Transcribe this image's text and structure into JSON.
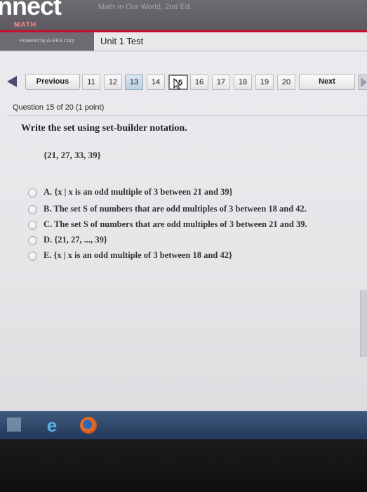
{
  "header": {
    "logo_text": "nnect",
    "subtitle": "Math in Our World, 2nd Ed.",
    "math_label": "MATH",
    "powered_by": "Powered by ALEKS Corp"
  },
  "test_title": "Unit 1 Test",
  "navigation": {
    "previous_label": "Previous",
    "next_label": "Next",
    "question_numbers": [
      "11",
      "12",
      "13",
      "14",
      "15",
      "16",
      "17",
      "18",
      "19",
      "20"
    ],
    "current_question": "15",
    "answered": [
      "13"
    ]
  },
  "question": {
    "info": "Question 15 of 20 (1 point)",
    "prompt": "Write the set using set-builder notation.",
    "set": "{21, 27, 33, 39}",
    "choices": [
      {
        "letter": "A.",
        "text": "{x | x is an odd multiple of 3 between 21 and 39}"
      },
      {
        "letter": "B.",
        "text": "The set S of numbers that are odd multiples of 3 between 18 and 42."
      },
      {
        "letter": "C.",
        "text": "The set S of numbers that are odd multiples of 3 between 21 and 39."
      },
      {
        "letter": "D.",
        "text": "{21, 27, ..., 39}"
      },
      {
        "letter": "E.",
        "text": "{x | x is an odd multiple of 3 between 18 and 42}"
      }
    ]
  },
  "colors": {
    "header_bg": "#6d6a70",
    "accent_red": "#c8102e",
    "taskbar_bg": "#2b4468"
  },
  "icons": {
    "left_arrow": "left-arrow-icon",
    "right_arrow": "right-arrow-icon",
    "radio": "radio-button",
    "ie": "internet-explorer-icon",
    "firefox": "firefox-icon",
    "start": "windows-start-icon"
  }
}
